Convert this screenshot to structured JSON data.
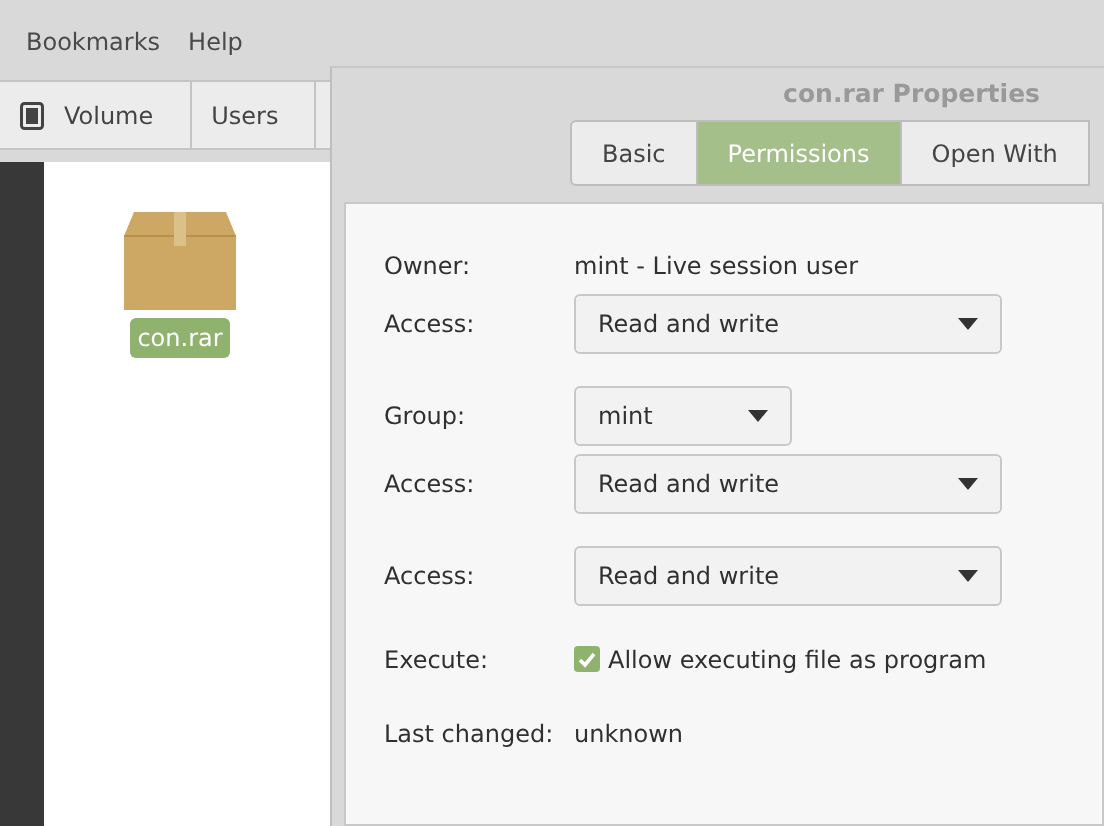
{
  "background_window": {
    "menu": [
      "Bookmarks",
      "Help"
    ],
    "toolbar": [
      {
        "label": "Volume",
        "kind": "drive"
      },
      {
        "label": "Users",
        "kind": "plain"
      }
    ],
    "files": [
      {
        "name": "con.rar",
        "selected": true
      }
    ]
  },
  "dialog": {
    "title": "con.rar Properties",
    "tabs": [
      {
        "label": "Basic",
        "selected": false
      },
      {
        "label": "Permissions",
        "selected": true
      },
      {
        "label": "Open With",
        "selected": false
      }
    ],
    "sections": [
      [
        {
          "kind": "text",
          "label": "Owner:",
          "value": "mint - Live session user"
        },
        {
          "kind": "dropdown",
          "label": "Access:",
          "value": "Read and write"
        }
      ],
      [
        {
          "kind": "short_dropdown",
          "label": "Group:",
          "value": "mint"
        },
        {
          "kind": "dropdown",
          "label": "Access:",
          "value": "Read and write"
        }
      ],
      [
        {
          "kind": "dropdown",
          "label": "Access:",
          "value": "Read and write"
        }
      ],
      [
        {
          "kind": "checkbox",
          "label": "Execute:",
          "value": "Allow executing file as program",
          "checked": true
        }
      ],
      [
        {
          "kind": "text",
          "label": "Last changed:",
          "value": "unknown"
        }
      ]
    ]
  }
}
